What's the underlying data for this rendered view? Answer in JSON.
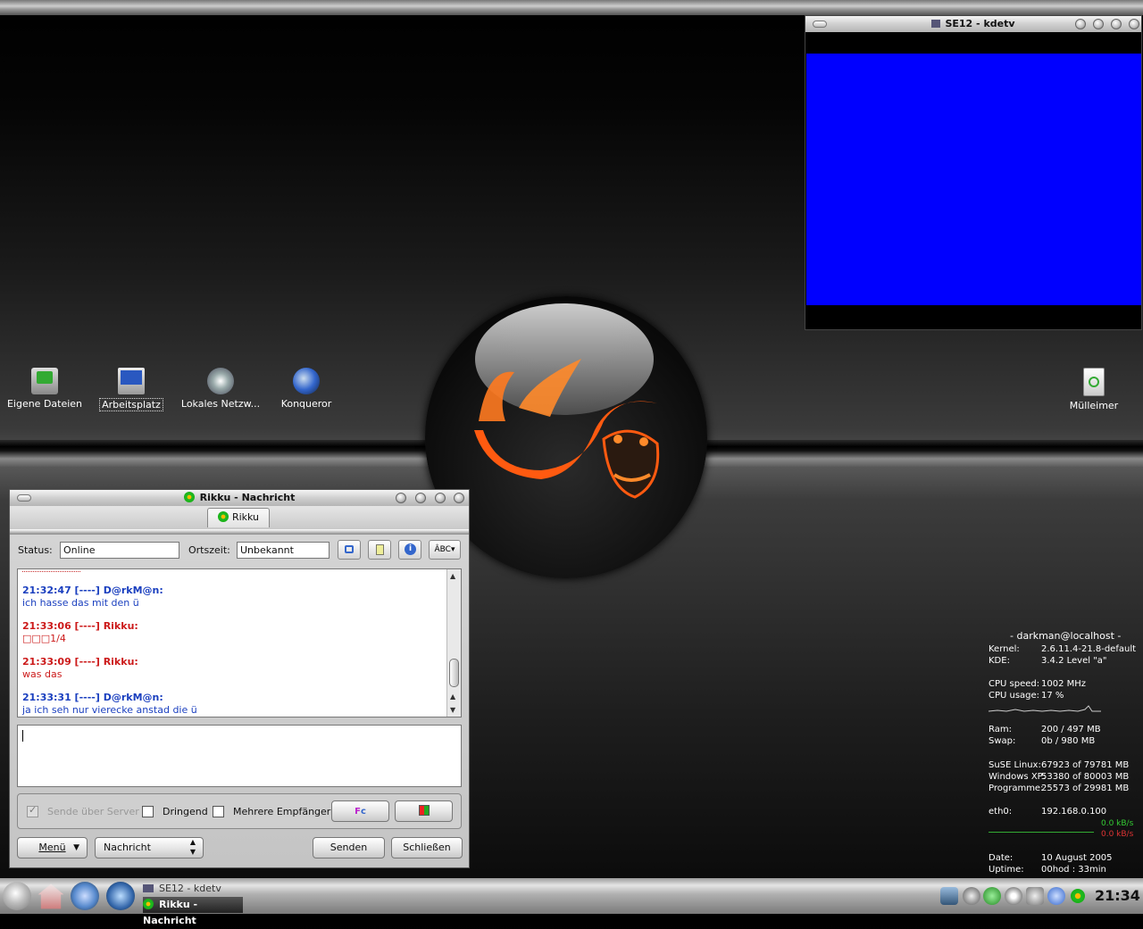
{
  "desktop": {
    "icons": [
      {
        "label": "Eigene Dateien"
      },
      {
        "label": "Arbeitsplatz"
      },
      {
        "label": "Lokales Netzw..."
      },
      {
        "label": "Konqueror"
      },
      {
        "label": "Mülleimer"
      }
    ]
  },
  "kdetv": {
    "title": "SE12 - kdetv",
    "screen_color": "#0000ff"
  },
  "chat": {
    "title": "Rikku - Nachricht",
    "tab": "Rikku",
    "status_label": "Status:",
    "status_value": "Online",
    "time_label": "Ortszeit:",
    "time_value": "Unbekannt",
    "spell_label": "ÂBC▾",
    "messages": [
      {
        "header": "21:32:47 [----] D@rkM@n:",
        "text": "ich hasse das mit den ü",
        "color": "blue"
      },
      {
        "header": "21:33:06 [----] Rikku:",
        "text": "□□□1/4",
        "color": "red"
      },
      {
        "header": "21:33:09 [----] Rikku:",
        "text": "was das",
        "color": "red"
      },
      {
        "header": "21:33:31 [----] D@rkM@n:",
        "text": "ja ich seh nur vierecke anstad die ü",
        "color": "blue"
      }
    ],
    "options": {
      "server": "Sende über Server",
      "urgent": "Dringend",
      "multi": "Mehrere Empfänger"
    },
    "menu_button": "Menü",
    "type_select": "Nachricht",
    "send_button": "Senden",
    "close_button": "Schließen"
  },
  "sysinfo": {
    "user": "- darkman@localhost -",
    "rows1": [
      {
        "k": "Kernel:",
        "v": "2.6.11.4-21.8-default"
      },
      {
        "k": "KDE:",
        "v": "3.4.2 Level \"a\""
      }
    ],
    "rows2": [
      {
        "k": "CPU speed:",
        "v": "1002 MHz"
      },
      {
        "k": "CPU usage:",
        "v": "17 %"
      }
    ],
    "rows3": [
      {
        "k": "Ram:",
        "v": "200 / 497 MB"
      },
      {
        "k": "Swap:",
        "v": "0b / 980 MB"
      }
    ],
    "rows4": [
      {
        "k": "SuSE Linux:",
        "v": "67923 of 79781 MB"
      },
      {
        "k": "Windows XP:",
        "v": "53380 of 80003 MB"
      },
      {
        "k": "Programme:",
        "v": "25573 of 29981 MB"
      }
    ],
    "eth_label": "eth0:",
    "eth_ip": "192.168.0.100",
    "net_up": "0.0 kB/s",
    "net_down": "0.0 kB/s",
    "date_label": "Date:",
    "date_value": "10 August 2005",
    "uptime_label": "Uptime:",
    "uptime_value": "00hod : 33min"
  },
  "taskbar": {
    "tasks": [
      "SE12 - kdetv",
      "Rikku - Nachricht"
    ],
    "clock": "21:34"
  }
}
